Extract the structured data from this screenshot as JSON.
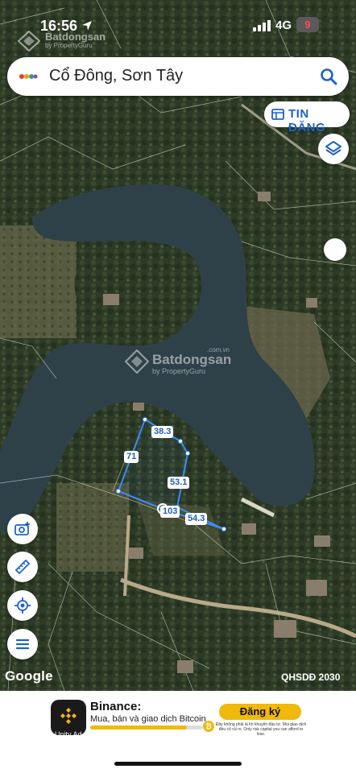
{
  "status_bar": {
    "time": "16:56",
    "network": "4G",
    "battery": "9"
  },
  "watermark": {
    "brand": "Batdongsan",
    "sub": "by PropertyGuru",
    "domain": ".com.vn"
  },
  "search": {
    "value": "Cổ Đông, Sơn Tây"
  },
  "tin_dang": {
    "label": "TIN ĐĂNG"
  },
  "plot": {
    "edges": [
      "38.3",
      "71",
      "53.1",
      "103",
      "54.3"
    ]
  },
  "map_footer": {
    "attribution": "Google",
    "layer_label": "QHSDĐ 2030"
  },
  "ad": {
    "title": "Binance:",
    "description": "Mua, bán và giao dịch Bitcoin",
    "button": "Đăng ký",
    "note": "Đây không phải là lời khuyên đầu tư. Mọi giao dịch đều có rủi ro. Only risk capital you can afford to lose.",
    "unity": "Unity Ad",
    "progress": 0.86
  },
  "icons": [
    "location-arrow-icon",
    "signal-icon",
    "search-icon",
    "list-icon",
    "layers-icon",
    "camera-add-icon",
    "ruler-icon",
    "my-location-icon",
    "menu-icon"
  ],
  "colors": {
    "accent": "#1e63c9",
    "plot_line": "#3b8cff",
    "ad_yellow": "#f0b90b"
  }
}
